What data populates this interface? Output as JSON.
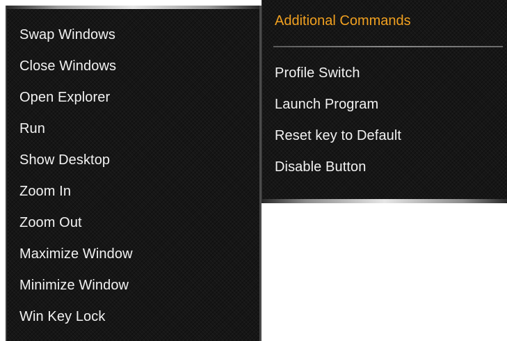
{
  "left_menu": {
    "items": [
      {
        "label": "Swap Windows"
      },
      {
        "label": "Close Windows"
      },
      {
        "label": "Open Explorer"
      },
      {
        "label": "Run"
      },
      {
        "label": "Show Desktop"
      },
      {
        "label": "Zoom In"
      },
      {
        "label": "Zoom Out"
      },
      {
        "label": "Maximize Window"
      },
      {
        "label": "Minimize Window"
      },
      {
        "label": "Win Key Lock"
      }
    ]
  },
  "right_menu": {
    "header": "Additional Commands",
    "items": [
      {
        "label": "Profile Switch"
      },
      {
        "label": "Launch Program"
      },
      {
        "label": "Reset key to Default"
      },
      {
        "label": "Disable Button"
      }
    ]
  },
  "colors": {
    "menu_background": "#161616",
    "item_text": "#f2f2f2",
    "header_text": "#f0a020",
    "page_background": "#ffffff"
  }
}
